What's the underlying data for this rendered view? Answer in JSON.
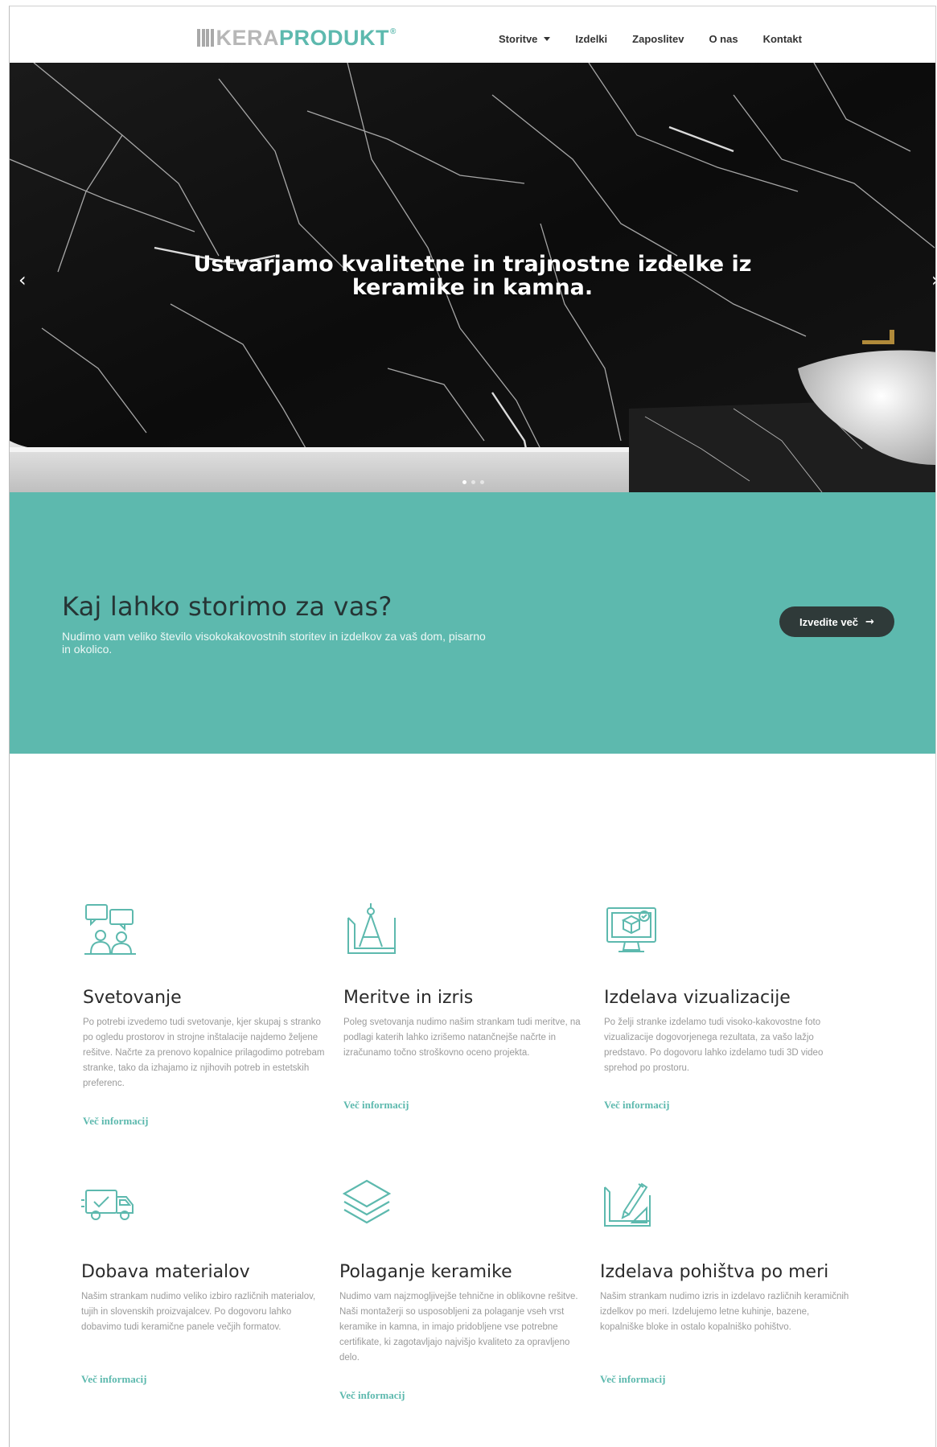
{
  "header": {
    "logo_part1": "KERA",
    "logo_part2": "PRODUKT",
    "logo_tm": "®",
    "nav": [
      {
        "label": "Storitve",
        "has_dropdown": true
      },
      {
        "label": "Izdelki"
      },
      {
        "label": "Zaposlitev"
      },
      {
        "label": "O nas"
      },
      {
        "label": "Kontakt"
      }
    ]
  },
  "hero": {
    "title_line1": "Ustvarjamo kvalitetne in trajnostne izdelke iz",
    "title_line2": "keramike in kamna.",
    "prev_icon": "chevron-left-icon",
    "next_icon": "chevron-right-icon",
    "slides": 3,
    "active_slide": 1
  },
  "band": {
    "title": "Kaj lahko storimo za vas?",
    "text": "Nudimo vam veliko število visokokakovostnih storitev in izdelkov za vaš dom, pisarno in okolico.",
    "button_label": "Izvedite več",
    "button_icon": "arrow-right-icon"
  },
  "services": [
    {
      "icon": "consulting-icon",
      "title": "Svetovanje",
      "text": "Po potrebi izvedemo tudi svetovanje, kjer skupaj s stranko po ogledu prostorov in strojne inštalacije najdemo željene rešitve. Načrte za prenovo kopalnice prilagodimo potrebam stranke, tako da izhajamo iz njihovih potreb in estetskih preferenc.",
      "link": "Več informacij"
    },
    {
      "icon": "measuring-drawing-icon",
      "title": "Meritve in izris",
      "text": "Poleg svetovanja nudimo našim strankam tudi meritve, na podlagi katerih lahko izrišemo natančnejše načrte in izračunamo točno stroškovno oceno projekta.",
      "link": "Več informacij"
    },
    {
      "icon": "visualization-monitor-icon",
      "title": "Izdelava vizualizacije",
      "text": "Po želji stranke izdelamo tudi visoko-kakovostne foto vizualizacije dogovorjenega rezultata, za vašo lažjo predstavo. Po dogovoru lahko izdelamo tudi 3D video sprehod po prostoru.",
      "link": "Več informacij"
    },
    {
      "icon": "delivery-truck-icon",
      "title": "Dobava materialov",
      "text": "Našim strankam nudimo veliko izbiro različnih materialov, tujih in slovenskih proizvajalcev. Po dogovoru lahko dobavimo tudi keramične panele večjih formatov.",
      "link": "Več informacij"
    },
    {
      "icon": "layers-icon",
      "title": "Polaganje keramike",
      "text": "Nudimo vam najzmogljivejše tehnične in oblikovne rešitve. Naši montažerji so usposobljeni za polaganje vseh vrst keramike in kamna, in imajo pridobljene vse potrebne certifikate, ki zagotavljajo najvišjo kvaliteto za opravljeno delo.",
      "link": "Več informacij"
    },
    {
      "icon": "custom-furniture-icon",
      "title": "Izdelava pohištva po meri",
      "text": "Našim strankam nudimo izris in izdelavo različnih keramičnih izdelkov po meri. Izdelujemo letne kuhinje, bazene, kopalniške bloke in ostalo kopalniško pohištvo.",
      "link": "Več informacij"
    }
  ],
  "colors": {
    "accent": "#5db9ae",
    "dark_button": "#2f3a39",
    "logo_gray": "#b7b7b7"
  }
}
